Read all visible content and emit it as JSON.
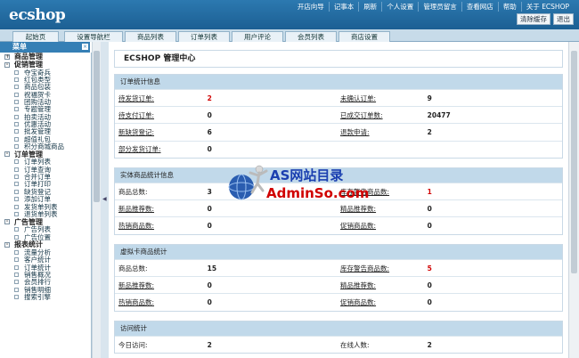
{
  "header": {
    "logo": "ecshop",
    "nav": [
      "开店向导",
      "记事本",
      "刷新",
      "个人设置",
      "管理员留言",
      "查看网店",
      "帮助",
      "关于 ECSHOP"
    ],
    "buttons": [
      "清除缓存",
      "退出"
    ]
  },
  "tabs": [
    "起始页",
    "设置导航栏",
    "商品列表",
    "订单列表",
    "用户评论",
    "会员列表",
    "商店设置"
  ],
  "sidebar": {
    "title": "菜单",
    "groups": [
      {
        "label": "商品管理",
        "expanded": false,
        "items": []
      },
      {
        "label": "促销管理",
        "expanded": true,
        "items": [
          "夺宝奇兵",
          "红包类型",
          "商品包装",
          "祝福贺卡",
          "团购活动",
          "专题管理",
          "拍卖活动",
          "优惠活动",
          "批发管理",
          "超值礼包",
          "积分商城商品"
        ]
      },
      {
        "label": "订单管理",
        "expanded": true,
        "items": [
          "订单列表",
          "订单查询",
          "合并订单",
          "订单打印",
          "缺货登记",
          "添加订单",
          "发货单列表",
          "退货单列表"
        ]
      },
      {
        "label": "广告管理",
        "expanded": true,
        "items": [
          "广告列表",
          "广告位置"
        ]
      },
      {
        "label": "报表统计",
        "expanded": true,
        "items": [
          "流量分析",
          "客户统计",
          "订单统计",
          "销售概况",
          "会员排行",
          "销售明细",
          "搜索引擎"
        ]
      }
    ]
  },
  "main": {
    "title": "ECSHOP 管理中心",
    "panels": [
      {
        "header": "订单统计信息",
        "rows": [
          [
            "待发货订单:",
            "2",
            "未确认订单:",
            "9"
          ],
          [
            "待支付订单:",
            "0",
            "已成交订单数:",
            "20477"
          ],
          [
            "新缺货登记:",
            "6",
            "退款申请:",
            "2"
          ],
          [
            "部分发货订单:",
            "0",
            "",
            ""
          ]
        ]
      },
      {
        "header": "实体商品统计信息",
        "rows": [
          [
            "商品总数:",
            "3",
            "库存警告商品数:",
            "1"
          ],
          [
            "新品推荐数:",
            "0",
            "精品推荐数:",
            "0"
          ],
          [
            "热销商品数:",
            "0",
            "促销商品数:",
            "0"
          ]
        ]
      },
      {
        "header": "虚拟卡商品统计",
        "rows": [
          [
            "商品总数:",
            "15",
            "库存警告商品数:",
            "5"
          ],
          [
            "新品推荐数:",
            "0",
            "精品推荐数:",
            "0"
          ],
          [
            "热销商品数:",
            "0",
            "促销商品数:",
            "0"
          ]
        ]
      },
      {
        "header": "访问统计",
        "rows": [
          [
            "今日访问:",
            "2",
            "在线人数:",
            "2"
          ]
        ]
      }
    ]
  },
  "watermark": {
    "line1": "AS网站目录",
    "line2": "AdminSo.com"
  },
  "colors": {
    "header_bg": "#2c79b0",
    "panel_header": "#c1d9ea",
    "alert_red": "#d00000",
    "watermark_blue": "#1a3fb0",
    "watermark_red": "#d00000"
  }
}
